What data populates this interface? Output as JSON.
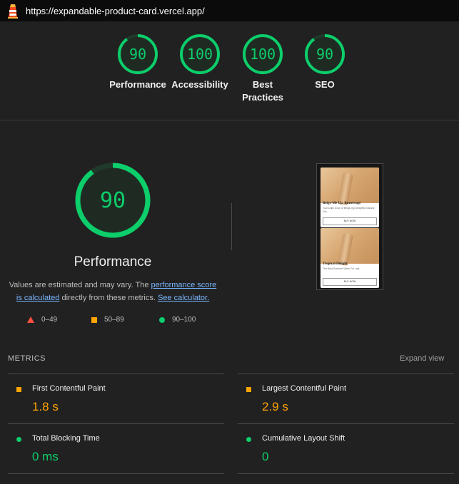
{
  "topbar": {
    "url": "https://expandable-product-card.vercel.app/"
  },
  "categories": [
    {
      "score": "90",
      "label": "Performance",
      "fraction": 0.9
    },
    {
      "score": "100",
      "label": "Accessibility",
      "fraction": 1.0
    },
    {
      "score": "100",
      "label": "Best Practices",
      "fraction": 1.0
    },
    {
      "score": "90",
      "label": "SEO",
      "fraction": 0.9
    }
  ],
  "performance": {
    "score": "90",
    "fraction": 0.9,
    "title": "Performance",
    "desc_prefix": "Values are estimated and may vary. The ",
    "link_score": "performance score is calculated",
    "desc_mid": " directly from these metrics. ",
    "link_calc": "See calculator."
  },
  "legend": [
    {
      "range": "0–49",
      "icon": "triangle-red-icon"
    },
    {
      "range": "50–89",
      "icon": "square-orange-icon"
    },
    {
      "range": "90–100",
      "icon": "circle-green-icon"
    }
  ],
  "screenshot": {
    "cards": [
      {
        "title": "Beige-Me Up, Buttercup!",
        "subtitle": "Your Daily Dose of Beige-ing Delightful Natural Glo...",
        "button": "BUY NOW"
      },
      {
        "title": "Tropical Delight",
        "subtitle": "The Best Summer Vibes For Lips",
        "button": "BUY NOW"
      }
    ]
  },
  "metrics": {
    "label": "METRICS",
    "expand": "Expand view",
    "items": [
      {
        "name": "First Contentful Paint",
        "value": "1.8 s",
        "status": "orange"
      },
      {
        "name": "Largest Contentful Paint",
        "value": "2.9 s",
        "status": "orange"
      },
      {
        "name": "Total Blocking Time",
        "value": "0 ms",
        "status": "green"
      },
      {
        "name": "Cumulative Layout Shift",
        "value": "0",
        "status": "green"
      }
    ]
  },
  "colors": {
    "pass": "#0cce6b",
    "average": "#ffa400",
    "fail": "#ff4e42",
    "link": "#78b5ff"
  }
}
